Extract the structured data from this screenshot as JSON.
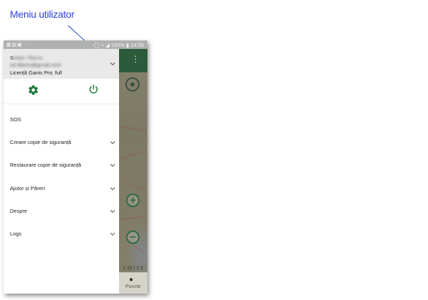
{
  "annotation": {
    "label": "Meniu utilizator",
    "color": "#2b3fd6"
  },
  "status_bar": {
    "left_icons": [
      "image-icon",
      "android-icon",
      "briefcase-icon",
      "more-icon"
    ],
    "battery": "100%",
    "time": "14:55"
  },
  "account": {
    "name_initial": "S",
    "name_rest": "tefan Tiberiu",
    "email": "sd.tiberiu@gmail.com",
    "license": "Licență Ganis Pro: full",
    "toggle_icon": "chevron-down-icon"
  },
  "actions": {
    "settings_icon": "gear-icon",
    "power_icon": "power-icon",
    "accent": "#1f7a3a"
  },
  "menu": {
    "items": [
      {
        "label": "SOS",
        "has_chevron": false
      },
      {
        "label": "Creare copie de siguranță",
        "has_chevron": true
      },
      {
        "label": "Restaurare copie de siguranță",
        "has_chevron": true
      },
      {
        "label": "Ajutor și Păreri",
        "has_chevron": true
      },
      {
        "label": "Despre",
        "has_chevron": true
      },
      {
        "label": "Logs",
        "has_chevron": true
      }
    ]
  },
  "map": {
    "scale_text": "1:18 | 2 8",
    "bottom_label": "Puncte"
  }
}
